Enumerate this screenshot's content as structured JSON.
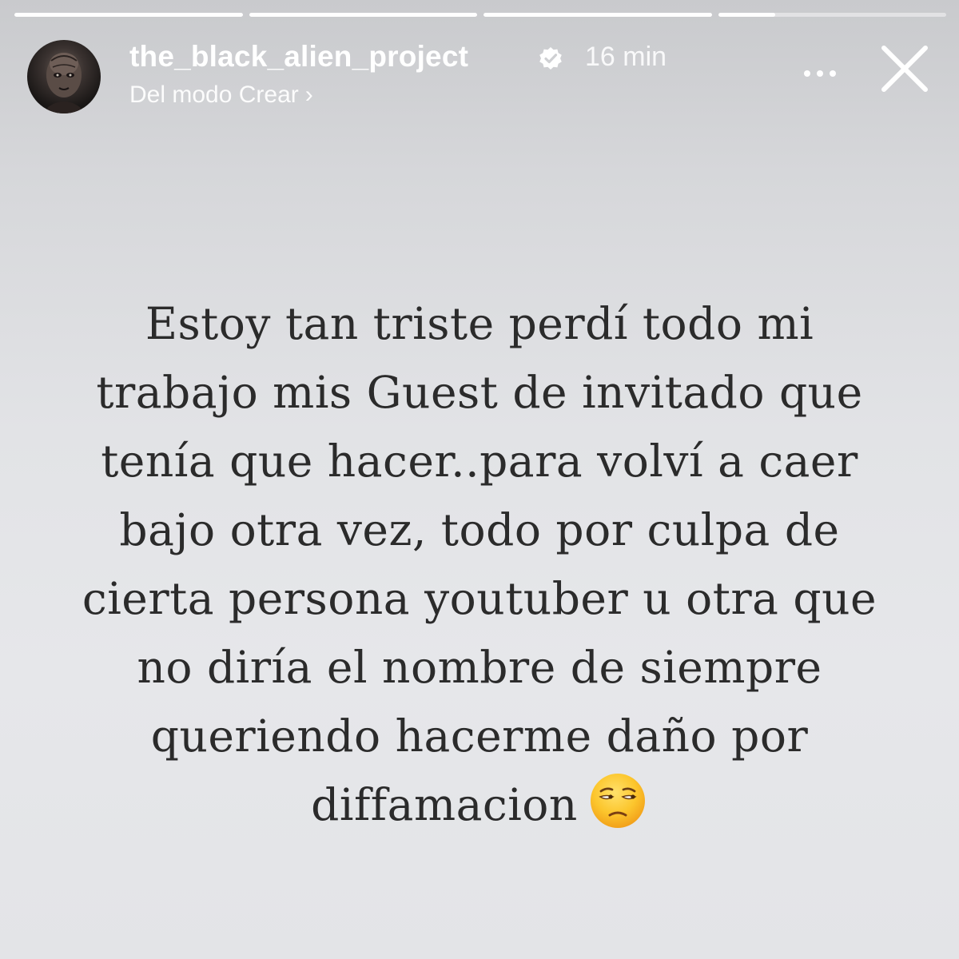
{
  "progress": {
    "segments": [
      1,
      1,
      1,
      0.25
    ]
  },
  "header": {
    "username": "the_black_alien_project",
    "verified": true,
    "time": "16 min",
    "subline": "Del modo Crear",
    "subline_chevron": "›",
    "more_icon": "more-horizontal-icon",
    "close_icon": "close-icon"
  },
  "story": {
    "lines": [
      "Estoy tan triste perdí todo mi",
      "trabajo mis Guest de invitado que",
      "tenía que hacer..para volví a caer",
      "bajo otra vez, todo por culpa de",
      "cierta persona youtuber u otra que",
      "no diría el nombre de siempre",
      "queriendo hacerme daño por",
      "diffamacion"
    ],
    "emoji": "unamused-face-emoji"
  },
  "colors": {
    "verified_badge": "#ffffff",
    "text": "#2b2b2b",
    "emoji_face": "#f7b81e"
  }
}
